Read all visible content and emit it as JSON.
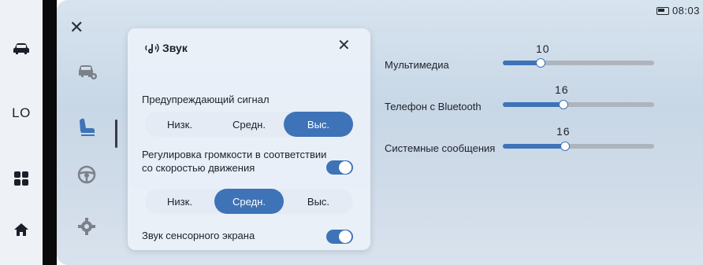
{
  "status": {
    "time": "08:03"
  },
  "left_rail": {
    "lo_label": "LO"
  },
  "modal": {
    "title": "Звук",
    "warning_label": "Предупреждающий сигнал",
    "warning_options": [
      "Низк.",
      "Средн.",
      "Выс."
    ],
    "warning_selected": "Выс.",
    "speed_volume_label_line1": "Регулировка громкости в соответствии",
    "speed_volume_label_line2": "со скоростью движения",
    "speed_volume_enabled": true,
    "speed_options": [
      "Низк.",
      "Средн.",
      "Выс."
    ],
    "speed_selected": "Средн.",
    "touch_sound_label": "Звук сенсорного экрана",
    "touch_sound_enabled": true
  },
  "volumes": [
    {
      "label": "Мультимедиа",
      "value": "10",
      "level": 0.25
    },
    {
      "label": "Телефон с Bluetooth",
      "value": "16",
      "level": 0.4
    },
    {
      "label": "Системные сообщения",
      "value": "16",
      "level": 0.41
    }
  ],
  "colors": {
    "accent": "#3e73b7",
    "text": "#1d2129"
  }
}
